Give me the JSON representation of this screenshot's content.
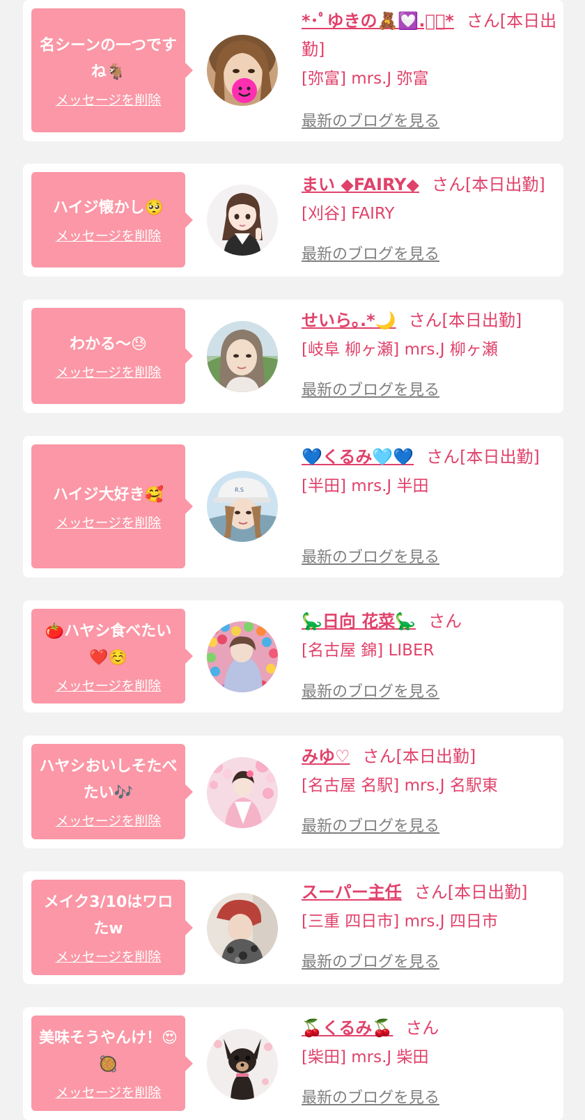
{
  "colors": {
    "background": "#f2f2f2",
    "card": "#ffffff",
    "bubble": "#fb97a6",
    "accent_text": "#e0416a",
    "blog_link": "#7f7f7f"
  },
  "delete_label": "メッセージを削除",
  "blog_label": "最新のブログを見る",
  "entries": [
    {
      "message": "名シーンの一つですね🐐",
      "name": "*･ﾟゆきの🧸💟.ﾟ･*",
      "suffix": "さん[本日出勤]",
      "shop": "[弥富] mrs.J 弥富",
      "avatar_icon": "woman-photo-heart-sticker"
    },
    {
      "message": "ハイジ懐かし🥺",
      "name": "まい ◆FAIRY◆",
      "suffix": "さん[本日出勤]",
      "shop": "[刈谷] FAIRY",
      "avatar_icon": "illustrated-girl-peace-sign"
    },
    {
      "message": "わかる〜😓",
      "name": "せいら｡.*🌙",
      "suffix": "さん[本日出勤]",
      "shop": "[岐阜 柳ヶ瀬] mrs.J 柳ヶ瀬",
      "avatar_icon": "woman-photo-outdoor"
    },
    {
      "message": "ハイジ大好き🥰",
      "name": "💙くるみ🩵💙",
      "suffix": "さん[本日出勤]",
      "shop": "[半田] mrs.J 半田",
      "avatar_icon": "woman-photo-white-cap"
    },
    {
      "message": "🍅ハヤシ食べたい❤️☺️",
      "name": "🦕日向 花菜🦕",
      "suffix": "さん",
      "shop": "[名古屋 錦] LIBER",
      "avatar_icon": "woman-photo-ball-pit"
    },
    {
      "message": "ハヤシおいしそたべたい🎶",
      "name": "みゆ♡",
      "suffix": "さん[本日出勤]",
      "shop": "[名古屋 名駅] mrs.J 名駅東",
      "avatar_icon": "woman-photo-kimono-blossom"
    },
    {
      "message": "メイク3/10はワロたw",
      "name": "スーパー主任",
      "suffix": "さん[本日出勤]",
      "shop": "[三重 四日市] mrs.J 四日市",
      "avatar_icon": "woman-photo-red-hair"
    },
    {
      "message": "美味そうやんけ！😍🥘",
      "name": "🍒くるみ🍒",
      "suffix": "さん",
      "shop": "[柴田] mrs.J 柴田",
      "avatar_icon": "chihuahua-dog-photo"
    }
  ]
}
